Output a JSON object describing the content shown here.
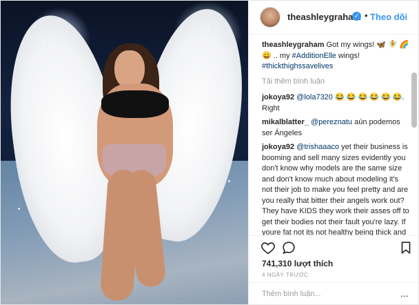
{
  "post": {
    "username": "theashleygraham",
    "follow_label": "Theo dõi",
    "separator": "•",
    "verified_icon": "verified-badge-icon",
    "caption_user": "theashleygraham",
    "caption_text_1": "Got my wings! 🦋 🧚 🌈",
    "caption_text_2": "😄 .. my ",
    "caption_tag_1": "#AdditionElle",
    "caption_text_3": " wings!",
    "caption_tag_2": "#thickthighssavelives",
    "load_more": "Tải thêm bình luận",
    "likes": "741,310 lượt thích",
    "time": "4 NGÀY TRƯỚC",
    "add_comment_placeholder": "Thêm bình luận...",
    "more_options": "..."
  },
  "comments": [
    {
      "user": "jokoya92",
      "mention": "@lola7320",
      "text": " 😂 😂 😂 😂 😂 😂. Right"
    },
    {
      "user": "mikalblatter_",
      "mention": "@pereznatu",
      "text": " aún podemos ser Ángeles"
    },
    {
      "user": "jokoya92",
      "mention": "@trishaaaco",
      "text": " yet their business is booming and sell many sizes evidently you don't know why models are the same size and don't know much about modeling it's not their job to make you feel pretty and are you really that bitter their angels work out? They have KIDS they work their asses off to get their bodies not their fault you're lazy. If youre fat not its not healthy being thick and curvy isn't fat. And Ashley herself want. To be a vs model and she's bitter she doesn't have a job yet as one yet she never goes to rue castings sooo"
    }
  ],
  "icons": [
    "heart-icon",
    "comment-icon",
    "bookmark-icon",
    "more-options-icon"
  ],
  "colors": {
    "link": "#3897f0",
    "mention": "#003569",
    "text": "#262626",
    "muted": "#999999"
  }
}
